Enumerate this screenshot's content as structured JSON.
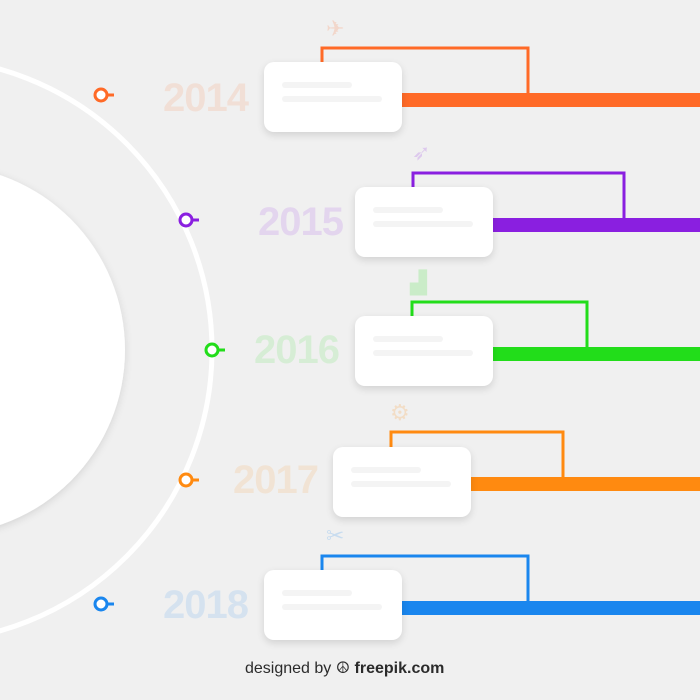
{
  "timeline": [
    {
      "year": "2014",
      "color": "#ff6a27",
      "icon": "plane-icon",
      "glyph": "✈"
    },
    {
      "year": "2015",
      "color": "#8a1fe0",
      "icon": "rocket-icon",
      "glyph": "➶"
    },
    {
      "year": "2016",
      "color": "#22dd1a",
      "icon": "chart-icon",
      "glyph": "▟"
    },
    {
      "year": "2017",
      "color": "#ff8a10",
      "icon": "gear-icon",
      "glyph": "⚙"
    },
    {
      "year": "2018",
      "color": "#1a86ee",
      "icon": "tools-icon",
      "glyph": "✂"
    }
  ],
  "credit": {
    "prefix": "designed by",
    "brand": "freepik.com"
  }
}
